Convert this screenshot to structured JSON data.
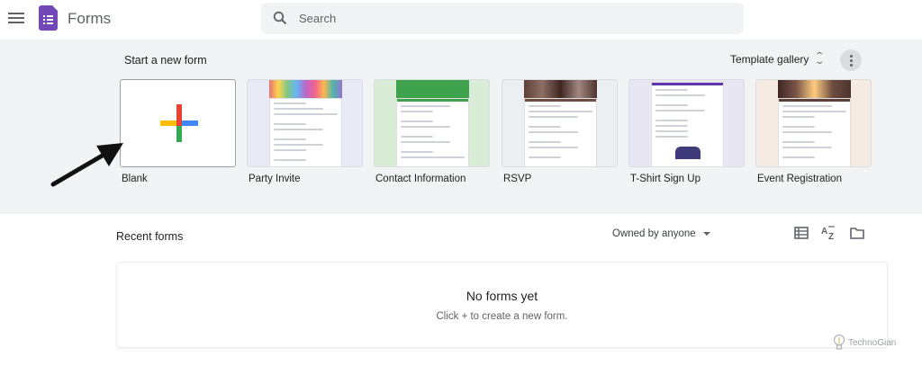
{
  "header": {
    "app_title": "Forms",
    "search_placeholder": "Search",
    "icons": [
      "menu-icon",
      "forms-logo",
      "search-icon"
    ]
  },
  "templates": {
    "section_label": "Start a new form",
    "gallery_label": "Template gallery",
    "items": [
      {
        "label": "Blank"
      },
      {
        "label": "Party Invite"
      },
      {
        "label": "Contact Information"
      },
      {
        "label": "RSVP"
      },
      {
        "label": "T-Shirt Sign Up"
      },
      {
        "label": "Event Registration"
      }
    ]
  },
  "recent": {
    "title": "Recent forms",
    "owner_filter": "Owned by anyone",
    "view_icons": [
      "list-view-icon",
      "sort-az-icon",
      "folder-icon"
    ],
    "empty_title": "No forms yet",
    "empty_subtitle": "Click + to create a new form."
  },
  "watermark": "TechnoGian",
  "colors": {
    "brand_purple": "#7248b9",
    "band_bg": "#f1f3f4",
    "plus_red": "#ea4335",
    "plus_blue": "#4285f4",
    "plus_green": "#34a853",
    "plus_yellow": "#fbbc04"
  }
}
